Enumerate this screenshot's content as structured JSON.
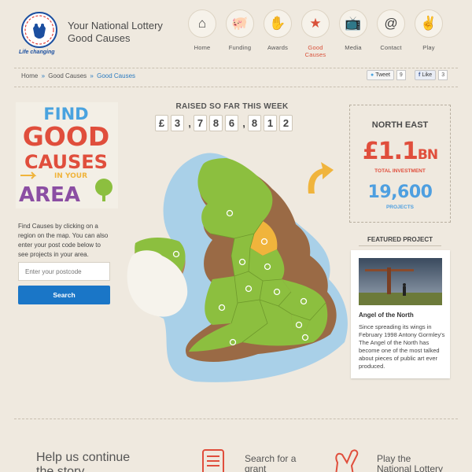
{
  "header": {
    "logo_tagline": "Life changing",
    "site_title_line1": "Your National Lottery",
    "site_title_line2": "Good Causes"
  },
  "nav": {
    "items": [
      {
        "label": "Home",
        "icon": "house-icon",
        "glyph": "⌂"
      },
      {
        "label": "Funding",
        "icon": "piggy-bank-icon",
        "glyph": "🐖"
      },
      {
        "label": "Awards",
        "icon": "awards-hand-icon",
        "glyph": "✋"
      },
      {
        "label": "Good Causes",
        "icon": "star-icon",
        "glyph": "★",
        "active": true
      },
      {
        "label": "Media",
        "icon": "tv-icon",
        "glyph": "📺"
      },
      {
        "label": "Contact",
        "icon": "at-icon",
        "glyph": "@"
      },
      {
        "label": "Play",
        "icon": "crossed-fingers-icon",
        "glyph": "✌"
      }
    ]
  },
  "breadcrumb": {
    "home": "Home",
    "sep": "»",
    "parent": "Good Causes",
    "current": "Good Causes"
  },
  "social": {
    "tweet_label": "Tweet",
    "tweet_count": "9",
    "like_label": "Like",
    "like_count": "3"
  },
  "find_causes": {
    "badge_line1": "FIND",
    "badge_line2": "GOOD",
    "badge_line3": "CAUSES",
    "badge_line4": "IN YOUR",
    "badge_line5": "AREA",
    "description": "Find Causes by clicking on a region on the map. You can also enter your post code below to see projects in your area.",
    "postcode_placeholder": "Enter your postcode",
    "search_label": "Search"
  },
  "raised": {
    "title": "RAISED SO FAR THIS WEEK",
    "digits": [
      "£",
      "3",
      ",",
      "7",
      "8",
      "6",
      ",",
      "8",
      "1",
      "2"
    ]
  },
  "region": {
    "name": "NORTH EAST",
    "investment_value": "£1.1",
    "investment_unit": "BN",
    "investment_label": "TOTAL INVESTMENT",
    "projects_value": "19,600",
    "projects_label": "PROJECTS"
  },
  "featured": {
    "title": "FEATURED PROJECT",
    "name": "Angel of the North",
    "description": "Since spreading its wings in February 1998 Antony Gormley's The Angel of the North has become one of the most talked about pieces of public art ever produced."
  },
  "footer": {
    "help_line1": "Help us continue",
    "help_line2": "the story",
    "search_line1": "Search for a",
    "search_line2": "grant",
    "play_line1": "Play the",
    "play_line2": "National Lottery"
  },
  "colors": {
    "accent_blue": "#1a76c7",
    "accent_red": "#e04e3c",
    "map_green": "#8cbf3f",
    "map_selected": "#f0b43c",
    "background": "#efe9df"
  }
}
